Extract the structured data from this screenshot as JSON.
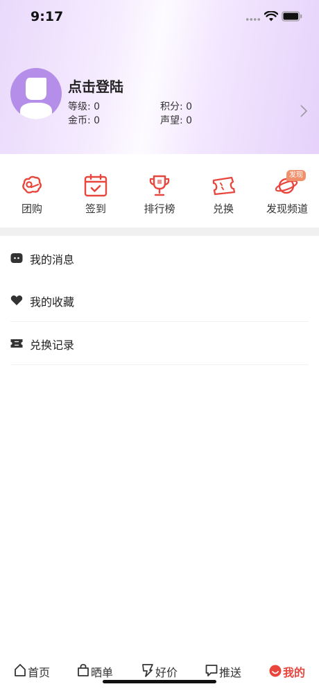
{
  "status_bar": {
    "time": "9:17"
  },
  "profile": {
    "name": "点击登陆",
    "level_label": "等级: 0",
    "points_label": "积分: 0",
    "coins_label": "金币: 0",
    "reputation_label": "声望: 0"
  },
  "quick_actions": [
    {
      "label": "团购",
      "icon": "group-buy-icon"
    },
    {
      "label": "签到",
      "icon": "calendar-checkin-icon"
    },
    {
      "label": "排行榜",
      "icon": "trophy-icon"
    },
    {
      "label": "兑换",
      "icon": "ticket-icon"
    },
    {
      "label": "发现频道",
      "icon": "planet-icon",
      "badge": "发现"
    }
  ],
  "menu": [
    {
      "label": "我的消息",
      "icon": "message-icon"
    },
    {
      "label": "我的收藏",
      "icon": "heart-icon"
    },
    {
      "label": "兑换记录",
      "icon": "ticket-record-icon"
    }
  ],
  "tabbar": {
    "tabs": [
      {
        "label": "首页",
        "icon": "home-icon"
      },
      {
        "label": "晒单",
        "icon": "bag-icon"
      },
      {
        "label": "好价",
        "icon": "price-tag-icon"
      },
      {
        "label": "推送",
        "icon": "chat-icon"
      },
      {
        "label": "我的",
        "icon": "profile-icon",
        "active": true
      }
    ]
  },
  "colors": {
    "accent": "#e8453c",
    "avatar_bg": "#b48ee8",
    "badge": "#f0916c"
  }
}
